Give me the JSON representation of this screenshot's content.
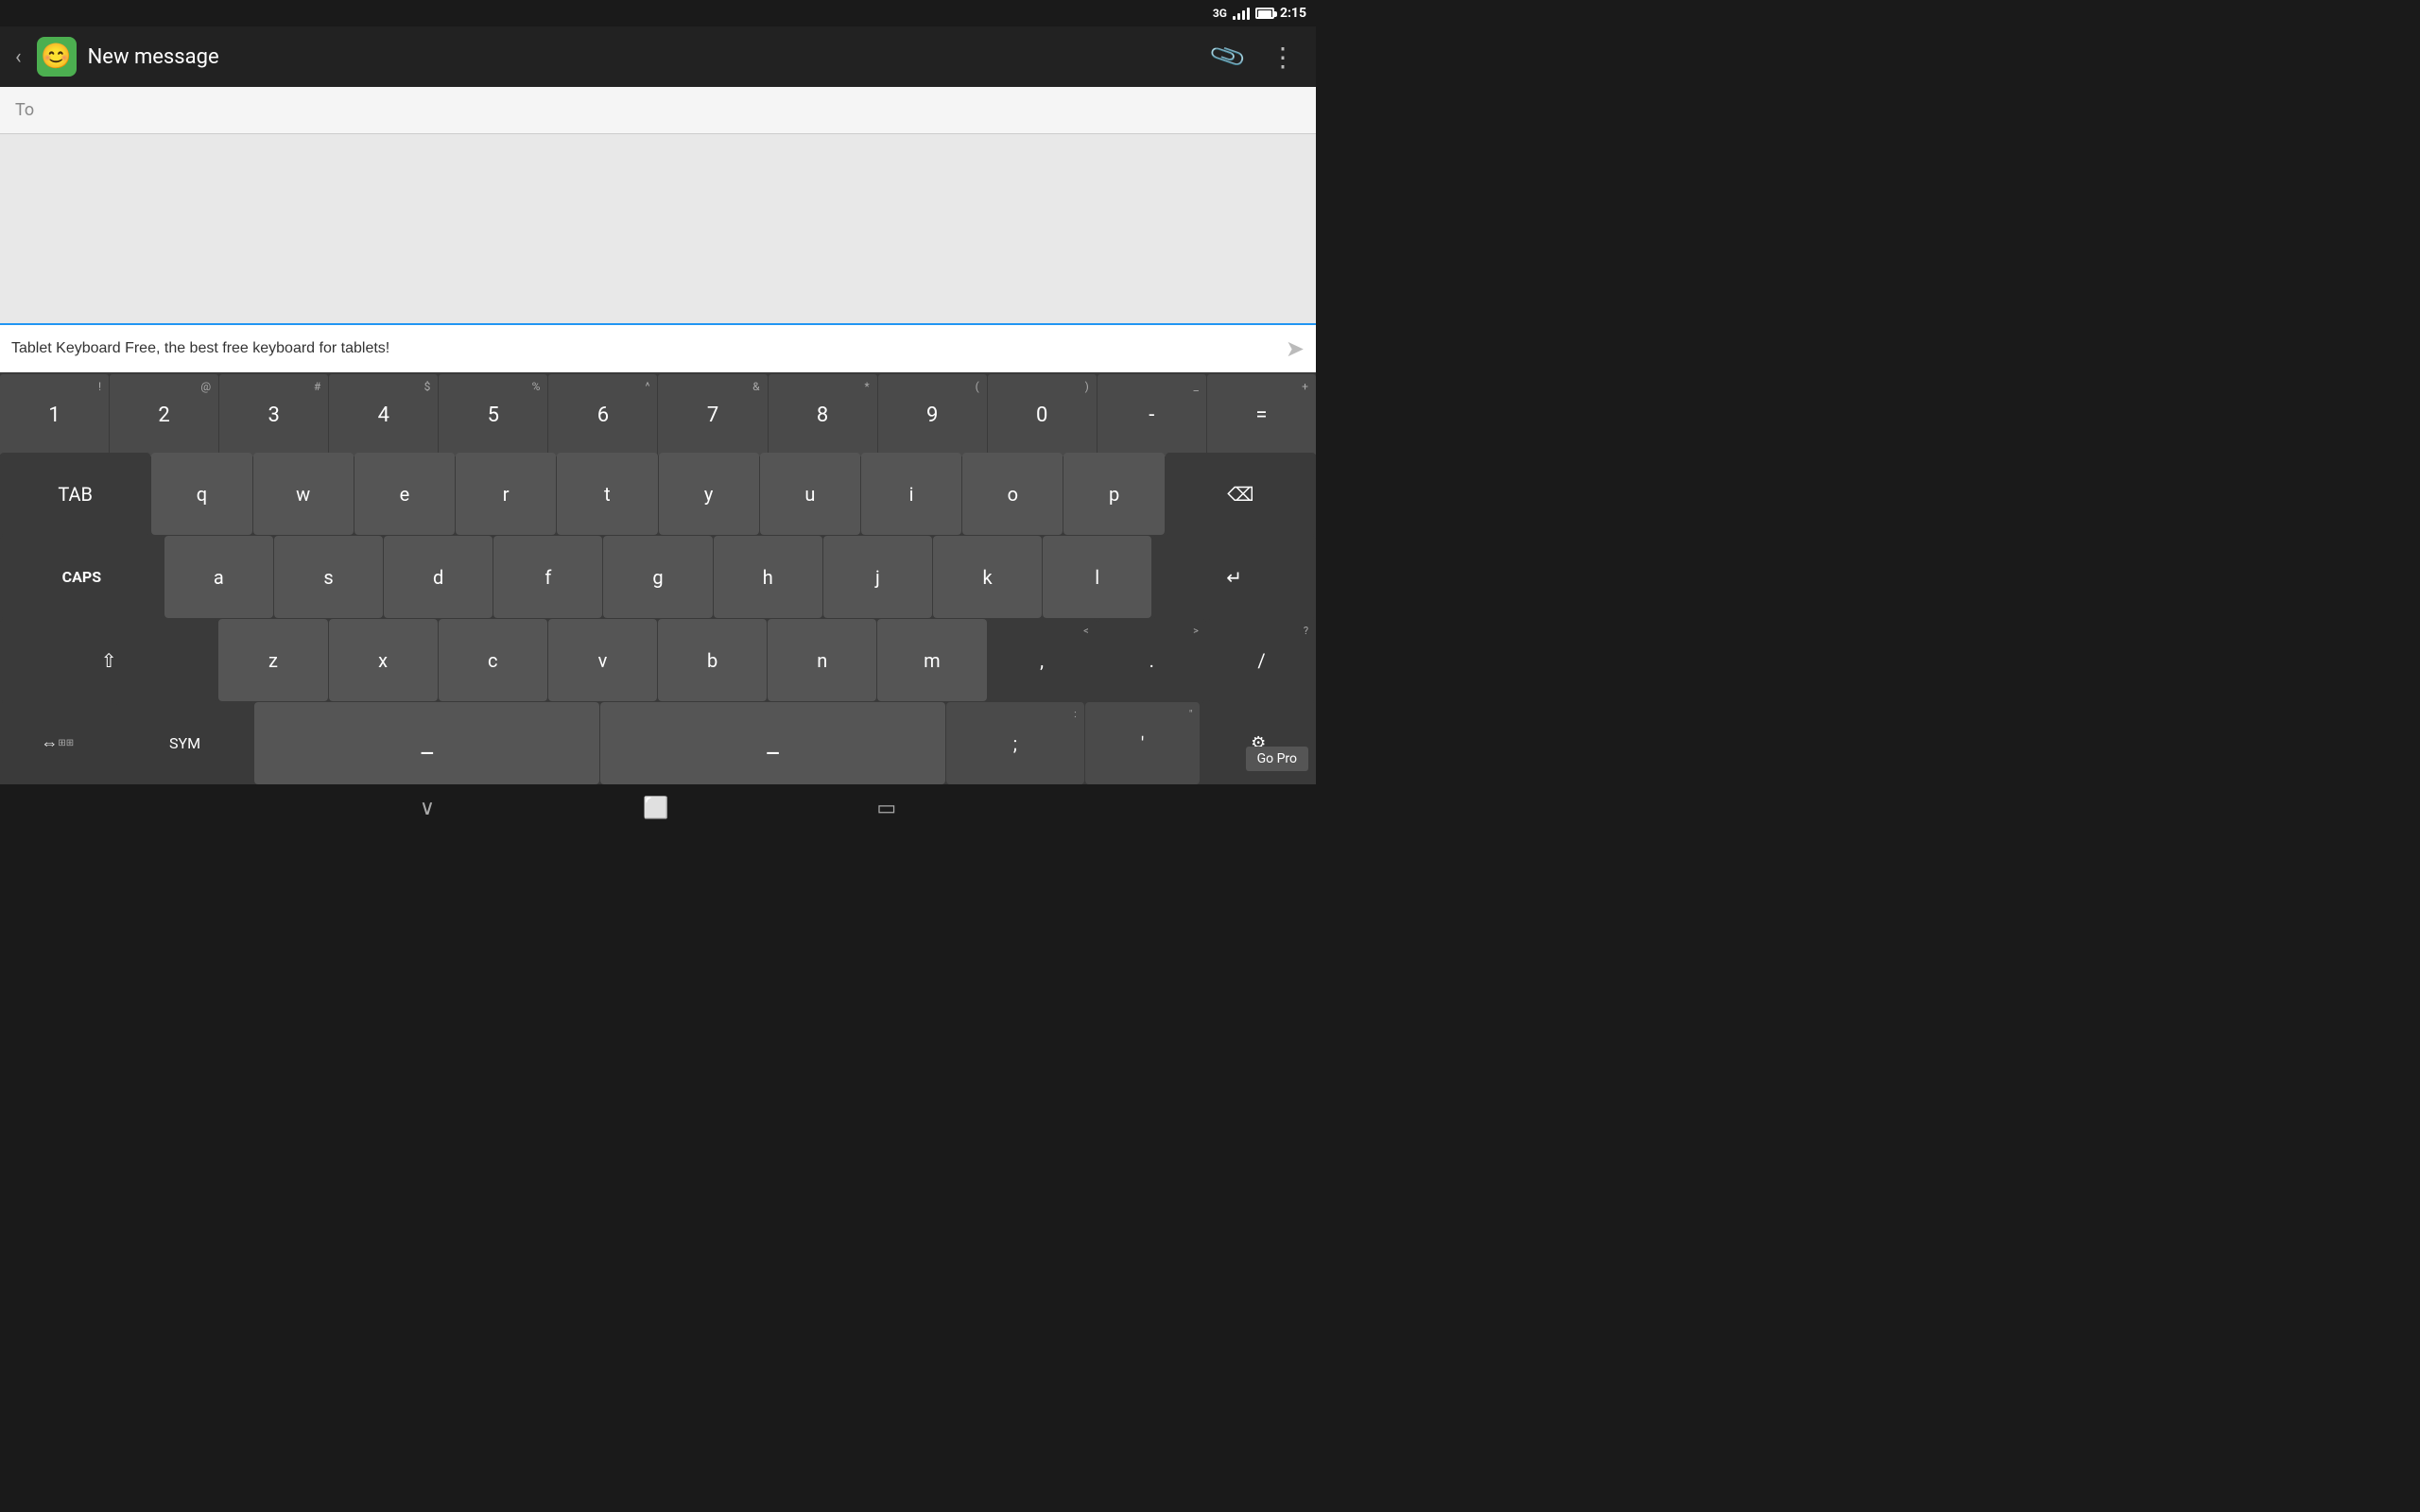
{
  "status_bar": {
    "network": "3G",
    "time": "2:15"
  },
  "app_bar": {
    "back_label": "‹",
    "icon_emoji": "😊",
    "title": "New message",
    "attach_icon": "📎",
    "menu_icon": "⋮"
  },
  "to_field": {
    "label": "To"
  },
  "text_input": {
    "value": "Tablet Keyboard Free, the best free keyboard for tablets!",
    "placeholder": ""
  },
  "keyboard": {
    "number_row": [
      {
        "main": "1",
        "alt": "!"
      },
      {
        "main": "2",
        "alt": "@"
      },
      {
        "main": "3",
        "alt": "#"
      },
      {
        "main": "4",
        "alt": "$"
      },
      {
        "main": "5",
        "alt": "%"
      },
      {
        "main": "6",
        "alt": "^"
      },
      {
        "main": "7",
        "alt": "&"
      },
      {
        "main": "8",
        "alt": "*"
      },
      {
        "main": "9",
        "alt": "("
      },
      {
        "main": "0",
        "alt": ")"
      },
      {
        "main": "-",
        "alt": "_"
      },
      {
        "main": "=",
        "alt": "+"
      }
    ],
    "row_qwerty": [
      "q",
      "w",
      "e",
      "r",
      "t",
      "y",
      "u",
      "i",
      "o",
      "p"
    ],
    "row_asdf": [
      "a",
      "s",
      "d",
      "f",
      "g",
      "h",
      "j",
      "k",
      "l"
    ],
    "row_zxcv": [
      "z",
      "x",
      "c",
      "v",
      "b",
      "n",
      "m"
    ],
    "special": {
      "tab": "TAB",
      "caps": "CAPS",
      "shift": "⇧",
      "backspace": "⌫",
      "enter": "↵",
      "comma": ",",
      "period": ".",
      "slash": "/",
      "lt": "<",
      "gt": ">",
      "question": "?",
      "layout": "⇔",
      "sym": "SYM",
      "semicolon": ";",
      "colon": ":",
      "quote": "'",
      "dquote": "\"",
      "settings": "⚙",
      "go_pro": "Go Pro",
      "send": "➤"
    },
    "nav": {
      "back": "∨",
      "home": "⬜",
      "recents": "▭"
    }
  }
}
